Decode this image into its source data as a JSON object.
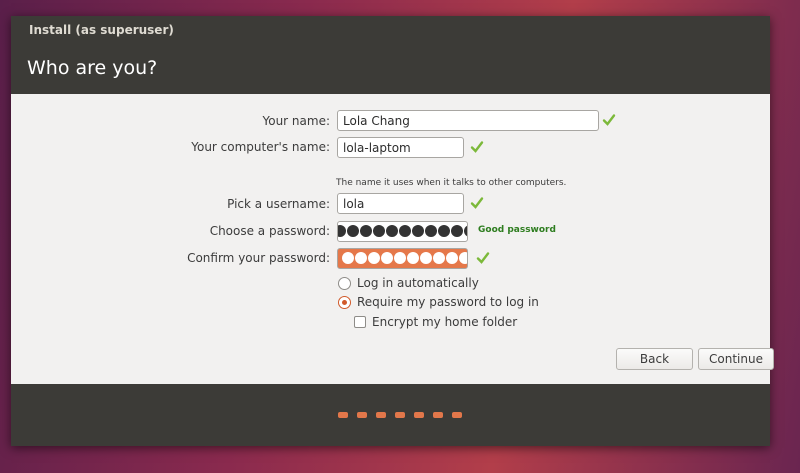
{
  "window": {
    "title": "Install (as superuser)",
    "heading": "Who are you?"
  },
  "form": {
    "name_label": "Your name:",
    "name_value": "Lola Chang",
    "computer_label": "Your computer's name:",
    "computer_value": "lola-laptom",
    "computer_hint": "The name it uses when it talks to other computers.",
    "username_label": "Pick a username:",
    "username_value": "lola",
    "password_label": "Choose a password:",
    "password_strength": "Good password",
    "confirm_label": "Confirm your password:",
    "login_auto": "Log in automatically",
    "login_require": "Require my password to log in",
    "encrypt_home": "Encrypt my home folder",
    "selected_login": "login_require",
    "encrypt_checked": false
  },
  "buttons": {
    "back": "Back",
    "continue": "Continue"
  },
  "progress": {
    "steps": 7
  },
  "colors": {
    "accent": "#e2774a",
    "check": "#7cb93a",
    "strength": "#2e7d1f",
    "titlebar": "#3c3b37"
  },
  "icons": {
    "valid": "checkmark-icon"
  }
}
